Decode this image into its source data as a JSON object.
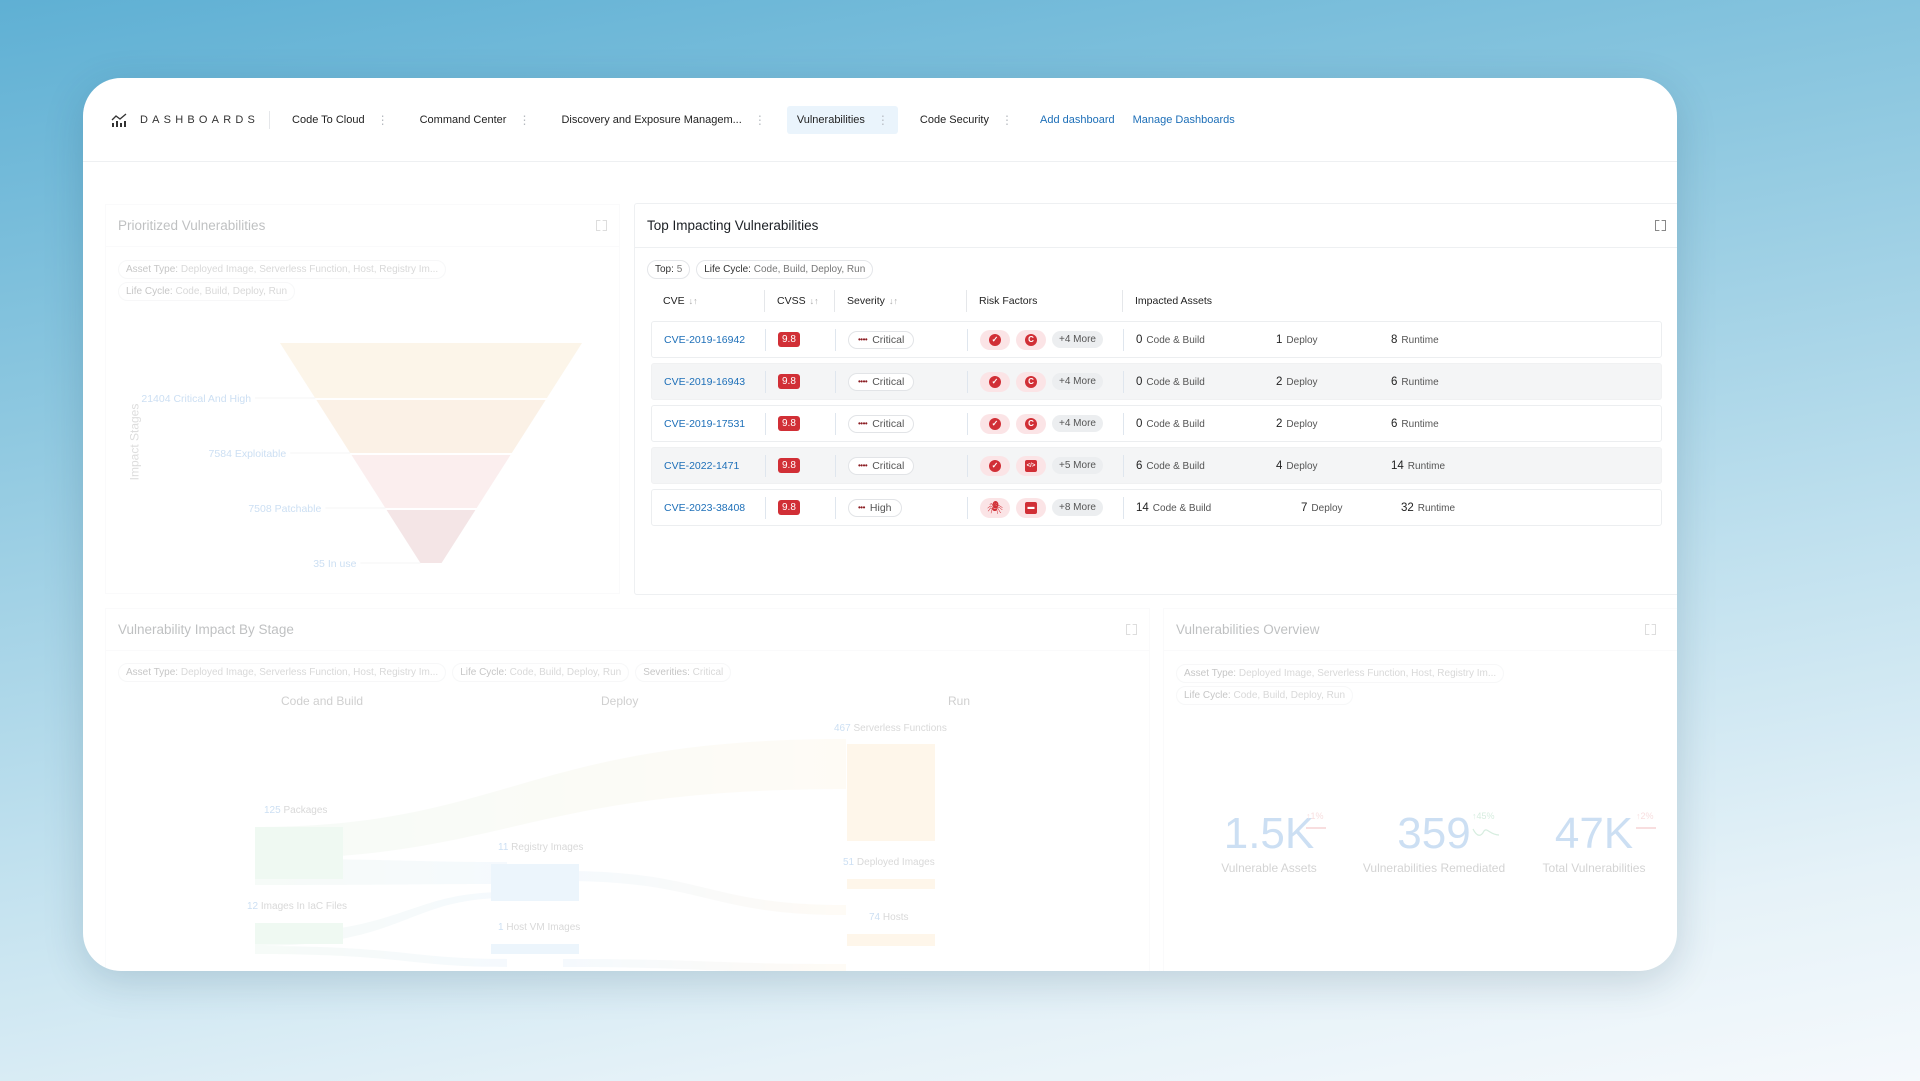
{
  "nav": {
    "brand": "DASHBOARDS",
    "tabs": [
      {
        "label": "Code To Cloud",
        "active": false
      },
      {
        "label": "Command Center",
        "active": false
      },
      {
        "label": "Discovery and Exposure Managem...",
        "active": false
      },
      {
        "label": "Vulnerabilities",
        "active": true
      },
      {
        "label": "Code Security",
        "active": false
      }
    ],
    "links": [
      "Add dashboard",
      "Manage Dashboards"
    ]
  },
  "prioritized": {
    "title": "Prioritized Vulnerabilities",
    "filters": [
      {
        "key": "Asset Type:",
        "value": "Deployed Image, Serverless Function, Host, Registry Im..."
      },
      {
        "key": "Life Cycle:",
        "value": "Code, Build, Deploy, Run"
      }
    ],
    "axis_label": "Impact Stages"
  },
  "chart_data": [
    {
      "type": "funnel",
      "title": "Prioritized Vulnerabilities",
      "ylabel": "Impact Stages",
      "categories": [
        "Critical And High",
        "Exploitable",
        "Patchable",
        "In use"
      ],
      "values": [
        21404,
        7584,
        7508,
        35
      ],
      "labels": [
        "21404 Critical And High",
        "7584 Exploitable",
        "7508 Patchable",
        "35 In use"
      ],
      "colors": [
        "#f5deb3",
        "#f1d0a8",
        "#f3c3c6",
        "#d8a3a8"
      ]
    },
    {
      "type": "sankey",
      "title": "Vulnerability Impact By Stage",
      "columns": [
        "Code and Build",
        "Deploy",
        "Run"
      ],
      "nodes": [
        {
          "stage": "Code and Build",
          "value": 125,
          "label": "Packages"
        },
        {
          "stage": "Code and Build",
          "value": 12,
          "label": "Images In IaC Files"
        },
        {
          "stage": "Deploy",
          "value": 11,
          "label": "Registry Images"
        },
        {
          "stage": "Deploy",
          "value": 1,
          "label": "Host VM Images"
        },
        {
          "stage": "Run",
          "value": 467,
          "label": "Serverless Functions"
        },
        {
          "stage": "Run",
          "value": 51,
          "label": "Deployed Images"
        },
        {
          "stage": "Run",
          "value": 74,
          "label": "Hosts"
        }
      ]
    }
  ],
  "top": {
    "title": "Top Impacting Vulnerabilities",
    "filters": [
      {
        "key": "Top:",
        "value": "5"
      },
      {
        "key": "Life Cycle:",
        "value": "Code, Build, Deploy, Run"
      }
    ],
    "columns": [
      "CVE",
      "CVSS",
      "Severity",
      "Risk Factors",
      "Impacted Assets"
    ],
    "asset_labels": [
      "Code & Build",
      "Deploy",
      "Runtime"
    ],
    "rows": [
      {
        "cve": "CVE-2019-16942",
        "cvss": "9.8",
        "severity": "Critical",
        "dots": "••••",
        "rf": [
          "check",
          "c"
        ],
        "more": "+4 More",
        "code": "0",
        "deploy": "1",
        "runtime": "8"
      },
      {
        "cve": "CVE-2019-16943",
        "cvss": "9.8",
        "severity": "Critical",
        "dots": "••••",
        "rf": [
          "check",
          "c"
        ],
        "more": "+4 More",
        "code": "0",
        "deploy": "2",
        "runtime": "6"
      },
      {
        "cve": "CVE-2019-17531",
        "cvss": "9.8",
        "severity": "Critical",
        "dots": "••••",
        "rf": [
          "check",
          "c"
        ],
        "more": "+4 More",
        "code": "0",
        "deploy": "2",
        "runtime": "6"
      },
      {
        "cve": "CVE-2022-1471",
        "cvss": "9.8",
        "severity": "Critical",
        "dots": "••••",
        "rf": [
          "check",
          "code"
        ],
        "more": "+5 More",
        "code": "6",
        "deploy": "4",
        "runtime": "14"
      },
      {
        "cve": "CVE-2023-38408",
        "cvss": "9.8",
        "severity": "High",
        "dots": "•••",
        "rf": [
          "bug",
          "archive"
        ],
        "more": "+8 More",
        "code": "14",
        "deploy": "7",
        "runtime": "32"
      }
    ]
  },
  "impact": {
    "title": "Vulnerability Impact By Stage",
    "filters": [
      {
        "key": "Asset Type:",
        "value": "Deployed Image, Serverless Function, Host, Registry Im..."
      },
      {
        "key": "Life Cycle:",
        "value": "Code, Build, Deploy, Run"
      },
      {
        "key": "Severities:",
        "value": "Critical"
      }
    ],
    "columns": [
      "Code and Build",
      "Deploy",
      "Run"
    ],
    "nodes": {
      "packages": {
        "n": "125",
        "l": "Packages"
      },
      "iac": {
        "n": "12",
        "l": "Images In IaC Files"
      },
      "registry": {
        "n": "11",
        "l": "Registry Images"
      },
      "hostvm": {
        "n": "1",
        "l": "Host VM Images"
      },
      "serverless": {
        "n": "467",
        "l": "Serverless Functions"
      },
      "deployed": {
        "n": "51",
        "l": "Deployed Images"
      },
      "hosts": {
        "n": "74",
        "l": "Hosts"
      }
    }
  },
  "overview": {
    "title": "Vulnerabilities Overview",
    "filters": [
      {
        "key": "Asset Type:",
        "value": "Deployed Image, Serverless Function, Host, Registry Im..."
      },
      {
        "key": "Life Cycle:",
        "value": "Code, Build, Deploy, Run"
      }
    ],
    "kpis": [
      {
        "value": "1.5K",
        "delta": "↑1%",
        "label": "Vulnerable Assets",
        "trend_color": "#e88a8f"
      },
      {
        "value": "359",
        "delta": "↑45%",
        "label": "Vulnerabilities Remediated",
        "trend_color": "#6fbf8f"
      },
      {
        "value": "47K",
        "delta": "↑2%",
        "label": "Total Vulnerabilities",
        "trend_color": "#e88a8f"
      }
    ]
  }
}
